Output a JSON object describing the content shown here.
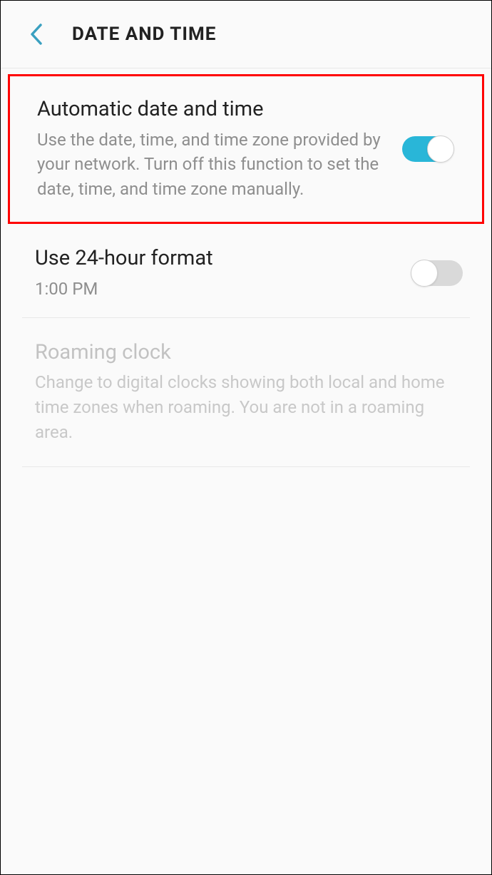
{
  "header": {
    "title": "DATE AND TIME"
  },
  "settings": {
    "auto": {
      "title": "Automatic date and time",
      "desc": "Use the date, time, and time zone provided by your network. Turn off this function to set the date, time, and time zone manually."
    },
    "format24": {
      "title": "Use 24-hour format",
      "desc": "1:00 PM"
    },
    "roaming": {
      "title": "Roaming clock",
      "desc": "Change to digital clocks showing both local and home time zones when roaming. You are not in a roaming area."
    }
  }
}
